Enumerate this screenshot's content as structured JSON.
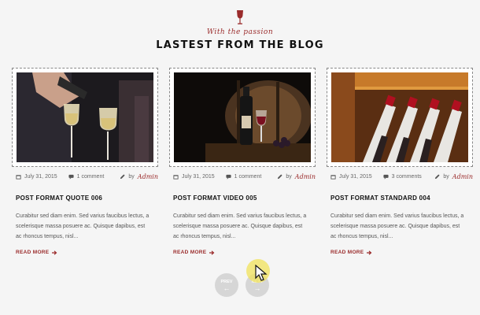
{
  "header": {
    "tagline": "With the passion",
    "title": "LASTEST FROM THE BLOG"
  },
  "posts": [
    {
      "date": "July 31, 2015",
      "comments": "1 comment",
      "by": "by",
      "author": "Admin",
      "title": "POST FORMAT QUOTE 006",
      "excerpt": "Curabitur sed diam enim. Sed varius faucibus lectus, a scelerisque massa posuere ac. Quisque dapibus, est ac rhoncus tempus, nisl...",
      "read_more": "READ MORE"
    },
    {
      "date": "July 31, 2015",
      "comments": "1 comment",
      "by": "by",
      "author": "Admin",
      "title": "POST FORMAT VIDEO 005",
      "excerpt": "Curabitur sed diam enim. Sed varius faucibus lectus, a scelerisque massa posuere ac. Quisque dapibus, est ac rhoncus tempus, nisl...",
      "read_more": "READ MORE"
    },
    {
      "date": "July 31, 2015",
      "comments": "3 comments",
      "by": "by",
      "author": "Admin",
      "title": "POST FORMAT STANDARD 004",
      "excerpt": "Curabitur sed diam enim. Sed varius faucibus lectus, a scelerisque massa posuere ac. Quisque dapibus, est ac rhoncus tempus, nisl...",
      "read_more": "READ MORE"
    }
  ],
  "nav": {
    "prev_label": "PREV",
    "next_label": "NEXT"
  },
  "icons": {
    "header": "wine-glass-icon",
    "date": "calendar-icon",
    "comments": "comment-icon",
    "author": "pencil-icon",
    "read_more": "arrow-right-icon"
  },
  "colors": {
    "accent": "#9a2b2b",
    "background": "#f5f5f5",
    "nav_button": "#d6d6d6",
    "cursor_highlight": "#f0e25a"
  }
}
